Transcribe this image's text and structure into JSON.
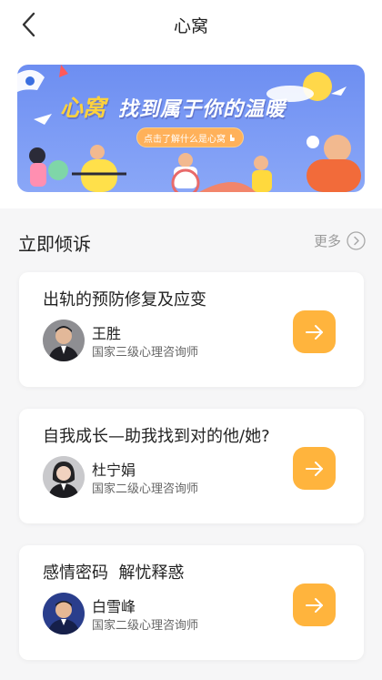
{
  "nav": {
    "title": "心窝",
    "back_icon": "chevron-left-icon"
  },
  "banner": {
    "logo_text": "心窝",
    "slogan": "找到属于你的温暖",
    "pill_text": "点击了解什么是心窝",
    "colors": {
      "background": "#7a98f4",
      "logo": "#ffd23c",
      "pill": "#ffb15a"
    }
  },
  "section": {
    "title": "立即倾诉",
    "more_label": "更多",
    "more_icon": "chevron-right-circle-icon"
  },
  "cards": [
    {
      "title": "出轨的预防修复及应变",
      "name": "王胜",
      "role": "国家三级心理咨询师",
      "action_icon": "arrow-right-icon"
    },
    {
      "title": "自我成长—助我找到对的他/她?",
      "name": "杜宁娟",
      "role": "国家二级心理咨询师",
      "action_icon": "arrow-right-icon"
    },
    {
      "title": "感情密码  解忧释惑",
      "name": "白雪峰",
      "role": "国家二级心理咨询师",
      "action_icon": "arrow-right-icon"
    }
  ],
  "accent_color": "#ffb43d"
}
